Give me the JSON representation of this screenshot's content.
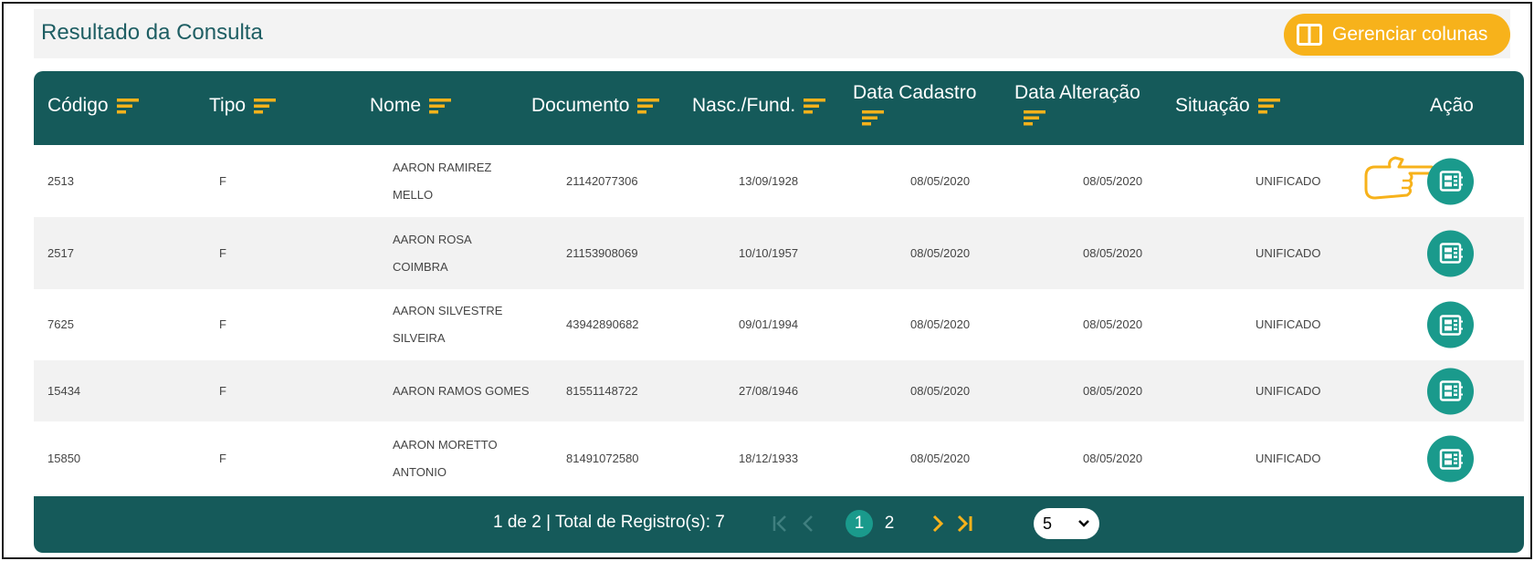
{
  "header": {
    "title": "Resultado da Consulta",
    "manage_columns_label": "Gerenciar colunas"
  },
  "colors": {
    "header_bg": "#155a5a",
    "accent_orange": "#f7b21b",
    "action_teal": "#1a9a8c",
    "title_color": "#1e5e63"
  },
  "table": {
    "columns": [
      {
        "label": "Código",
        "sortable": true
      },
      {
        "label": "Tipo",
        "sortable": true
      },
      {
        "label": "Nome",
        "sortable": true
      },
      {
        "label": "Documento",
        "sortable": true
      },
      {
        "label": "Nasc./Fund.",
        "sortable": true
      },
      {
        "label": "Data Cadastro",
        "sortable": true
      },
      {
        "label": "Data Alteração",
        "sortable": true
      },
      {
        "label": "Situação",
        "sortable": true
      },
      {
        "label": "Ação",
        "sortable": false
      }
    ],
    "rows": [
      {
        "codigo": "2513",
        "tipo": "F",
        "nome_l1": "AARON RAMIREZ",
        "nome_l2": "MELLO",
        "documento": "21142077306",
        "nasc": "13/09/1928",
        "cadastro": "08/05/2020",
        "alteracao": "08/05/2020",
        "situacao": "UNIFICADO"
      },
      {
        "codigo": "2517",
        "tipo": "F",
        "nome_l1": "AARON ROSA",
        "nome_l2": "COIMBRA",
        "documento": "21153908069",
        "nasc": "10/10/1957",
        "cadastro": "08/05/2020",
        "alteracao": "08/05/2020",
        "situacao": "UNIFICADO"
      },
      {
        "codigo": "7625",
        "tipo": "F",
        "nome_l1": "AARON SILVESTRE",
        "nome_l2": "SILVEIRA",
        "documento": "43942890682",
        "nasc": "09/01/1994",
        "cadastro": "08/05/2020",
        "alteracao": "08/05/2020",
        "situacao": "UNIFICADO"
      },
      {
        "codigo": "15434",
        "tipo": "F",
        "nome_l1": "AARON RAMOS GOMES",
        "nome_l2": "",
        "documento": "81551148722",
        "nasc": "27/08/1946",
        "cadastro": "08/05/2020",
        "alteracao": "08/05/2020",
        "situacao": "UNIFICADO"
      },
      {
        "codigo": "15850",
        "tipo": "F",
        "nome_l1": "AARON MORETTO",
        "nome_l2": "ANTONIO",
        "documento": "81491072580",
        "nasc": "18/12/1933",
        "cadastro": "08/05/2020",
        "alteracao": "08/05/2020",
        "situacao": "UNIFICADO"
      }
    ]
  },
  "pagination": {
    "summary": "1 de 2 | Total de Registro(s): 7",
    "pages": [
      "1",
      "2"
    ],
    "current_page": "1",
    "page_size": "5"
  },
  "icons": {
    "manage": "columns-icon",
    "sort": "sort-icon",
    "action": "details-card-icon",
    "pointer": "pointing-hand-icon"
  }
}
